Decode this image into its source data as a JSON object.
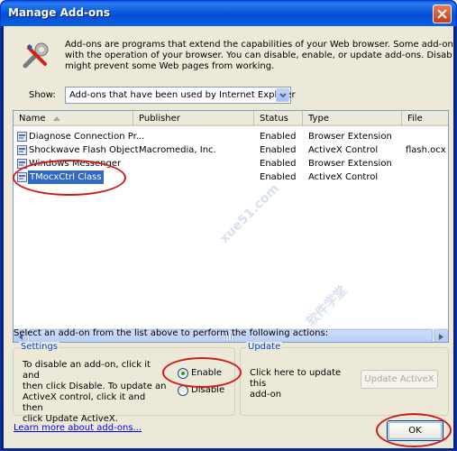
{
  "window": {
    "title": "Manage Add-ons"
  },
  "intro": {
    "lines": [
      "Add-ons are programs that extend the capabilities of your Web browser. Some add-ons can interfere",
      "with the operation of your browser. You can disable, enable, or update add-ons. Disabling an add-on",
      "might prevent some Web pages from working."
    ]
  },
  "show": {
    "label": "Show:",
    "value": "Add-ons that have been used by Internet Explorer"
  },
  "list": {
    "columns": [
      "Name",
      "Publisher",
      "Status",
      "Type",
      "File"
    ],
    "rows": [
      {
        "name": "Diagnose Connection Pr...",
        "publisher": "",
        "status": "Enabled",
        "type": "Browser Extension",
        "file": ""
      },
      {
        "name": "Shockwave Flash Object",
        "publisher": "Macromedia, Inc.",
        "status": "Enabled",
        "type": "ActiveX Control",
        "file": "flash.ocx"
      },
      {
        "name": "Windows Messenger",
        "publisher": "",
        "status": "Enabled",
        "type": "Browser Extension",
        "file": ""
      },
      {
        "name": "TMocxCtrl Class",
        "publisher": "",
        "status": "Enabled",
        "type": "ActiveX Control",
        "file": ""
      }
    ],
    "selected_row": "TMocxCtrl Class"
  },
  "actions_prompt": "Select an add-on from the list above to perform the following actions:",
  "settings": {
    "title": "Settings",
    "lines": [
      "To disable an add-on, click it and",
      "then click Disable. To update an",
      "ActiveX control, click it and then",
      "click Update ActiveX."
    ],
    "enable_label": "Enable",
    "disable_label": "Disable",
    "selected": "Enable"
  },
  "update": {
    "title": "Update",
    "lines": [
      "Click here to update this",
      "add-on"
    ],
    "button_label": "Update ActiveX"
  },
  "footer": {
    "link": "Learn more about add-ons...",
    "ok_label": "OK"
  },
  "watermark": {
    "text": "xue51.com",
    "cjk": "软件学堂"
  },
  "colors": {
    "title_bar": "#0a5bde",
    "dialog_bg": "#ece9d8",
    "selection": "#316ac5",
    "group_title": "#0046d5",
    "link": "#0000ff",
    "annotation": "#cc1b1b"
  },
  "icons": {
    "intro": "addon-tools-icon",
    "row": "addon-component-icon",
    "close": "close-icon"
  }
}
